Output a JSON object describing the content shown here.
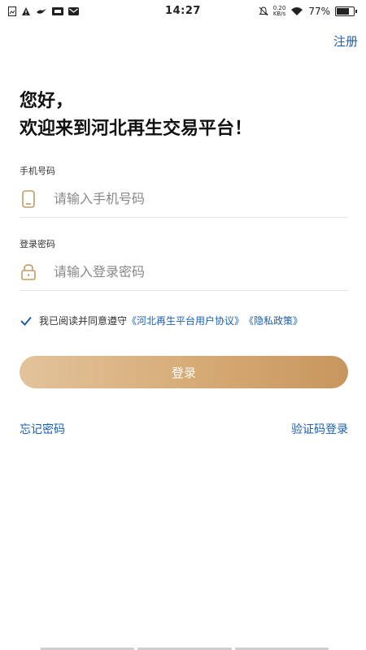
{
  "status_bar": {
    "time": "14:27",
    "net_speed_value": "0.20",
    "net_speed_unit": "KB/s",
    "battery": "77%",
    "battery_level": 0.77,
    "left_icons": [
      "image-icon",
      "warning-icon",
      "bird-icon",
      "hd-icon",
      "mail-icon"
    ],
    "right_icons": [
      "mute-icon",
      "wifi-icon",
      "battery-icon"
    ]
  },
  "header": {
    "register_label": "注册"
  },
  "greeting": {
    "line1": "您好，",
    "line2": "欢迎来到河北再生交易平台！"
  },
  "phone": {
    "label": "手机号码",
    "placeholder": "请输入手机号码",
    "value": ""
  },
  "password": {
    "label": "登录密码",
    "placeholder": "请输入登录密码",
    "value": ""
  },
  "agreement": {
    "checked": true,
    "text": "我已阅读并同意遵守",
    "user_agreement": "《河北再生平台用户协议》",
    "privacy": "《隐私政策》"
  },
  "login": {
    "label": "登录"
  },
  "links": {
    "forgot": "忘记密码",
    "sms_login": "验证码登录"
  },
  "colors": {
    "accent": "#1a5fb4",
    "button_start": "#e2c39b",
    "button_end": "#c7965e",
    "icon_gold": "#c49a63"
  }
}
